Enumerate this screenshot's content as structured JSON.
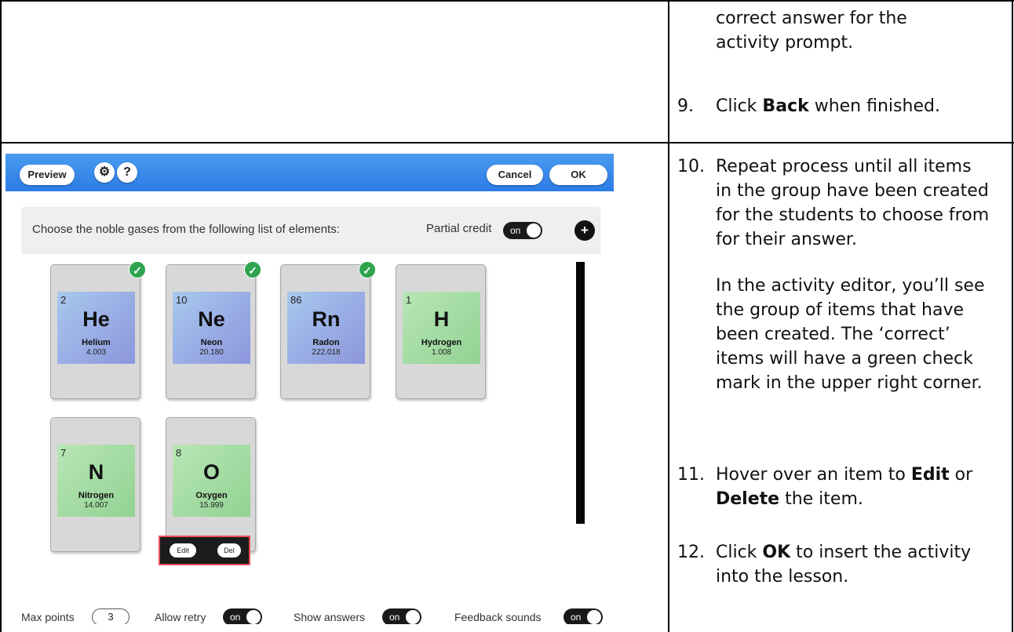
{
  "instructions": {
    "step8_cont_line1": "correct answer for the",
    "step8_cont_line2": "activity prompt.",
    "step9_num": "9.",
    "step9_pre": "Click ",
    "step9_bold": "Back",
    "step9_post": " when finished.",
    "step10_num": "10.",
    "step10_text": "Repeat process until all items in the group have been created for the students to choose from for their answer.",
    "step10_note": "In the activity editor, you’ll see the group of items that have been created. The ‘correct’ items will have a green check mark in the upper right corner.",
    "step11_num": "11.",
    "step11_pre": "Hover over an item to ",
    "step11_bold1": "Edit",
    "step11_mid": " or ",
    "step11_bold2": "Delete",
    "step11_post": " the item.",
    "step12_num": "12.",
    "step12_pre": "Click ",
    "step12_bold": "OK",
    "step12_post": " to insert the activity into the lesson."
  },
  "app": {
    "toolbar": {
      "preview_label": "Preview",
      "settings_icon": "gear-icon",
      "help_label": "?",
      "cancel_label": "Cancel",
      "ok_label": "OK"
    },
    "prompt": "Choose the noble gases from the following list of elements:",
    "partial_credit_label": "Partial credit",
    "partial_credit_state": "on",
    "add_label": "+",
    "cards": [
      {
        "number": "2",
        "symbol": "He",
        "name": "Helium",
        "mass": "4.003",
        "correct": true
      },
      {
        "number": "10",
        "symbol": "Ne",
        "name": "Neon",
        "mass": "20.180",
        "correct": true
      },
      {
        "number": "86",
        "symbol": "Rn",
        "name": "Radon",
        "mass": "222.018",
        "correct": true
      },
      {
        "number": "1",
        "symbol": "H",
        "name": "Hydrogen",
        "mass": "1.008",
        "correct": false
      },
      {
        "number": "7",
        "symbol": "N",
        "name": "Nitrogen",
        "mass": "14.007",
        "correct": false
      },
      {
        "number": "8",
        "symbol": "O",
        "name": "Oxygen",
        "mass": "15.999",
        "correct": false
      }
    ],
    "hover_actions": {
      "edit_label": "Edit",
      "delete_label": "Del"
    },
    "settings": {
      "max_points_label": "Max points",
      "max_points_value": "3",
      "allow_retry_label": "Allow retry",
      "allow_retry_state": "on",
      "show_answers_label": "Show answers",
      "show_answers_state": "on",
      "feedback_sounds_label": "Feedback sounds",
      "feedback_sounds_state": "on"
    },
    "colors": {
      "toolbar_blue": "#2c7ce6",
      "noble_tile": "#8c96dc",
      "other_tile": "#92d292",
      "check_green": "#2ea44f",
      "highlight_red": "#e8505b"
    }
  }
}
